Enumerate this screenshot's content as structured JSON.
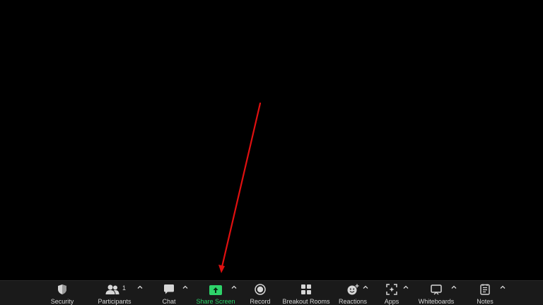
{
  "toolbar": {
    "security_label": "Security",
    "participants_label": "Participants",
    "participants_count": "1",
    "chat_label": "Chat",
    "share_screen_label": "Share Screen",
    "record_label": "Record",
    "breakout_rooms_label": "Breakout Rooms",
    "reactions_label": "Reactions",
    "apps_label": "Apps",
    "whiteboards_label": "Whiteboards",
    "notes_label": "Notes"
  },
  "icons": {
    "security": "shield-icon",
    "participants": "people-icon",
    "chat": "chat-bubble-icon",
    "share_screen": "share-up-arrow-icon",
    "record": "record-circle-icon",
    "breakout_rooms": "grid-icon",
    "reactions": "smiley-plus-icon",
    "apps": "apps-icon",
    "whiteboards": "whiteboard-icon",
    "notes": "notes-icon",
    "caret": "caret-up-icon"
  },
  "colors": {
    "background": "#000000",
    "toolbar": "#1a1a1a",
    "label": "#d6d6d6",
    "active_green": "#2ed36a",
    "annotation_red": "#e01010"
  }
}
